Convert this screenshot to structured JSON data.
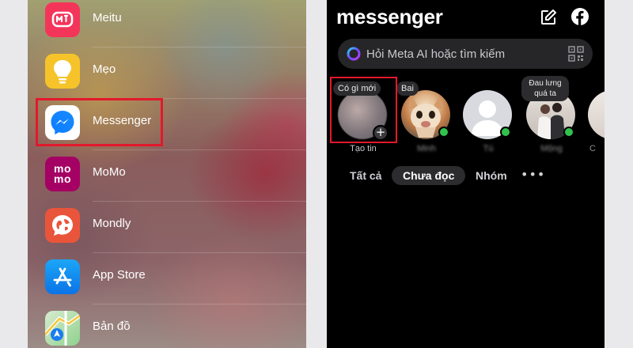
{
  "apps": [
    {
      "id": "meitu",
      "label": "Meitu",
      "icon": "meitu-icon"
    },
    {
      "id": "meo",
      "label": "Mẹo",
      "icon": "lightbulb-icon"
    },
    {
      "id": "messenger",
      "label": "Messenger",
      "icon": "messenger-icon"
    },
    {
      "id": "momo",
      "label": "MoMo",
      "icon": "momo-icon",
      "icon_text_top": "mo",
      "icon_text_bottom": "mo"
    },
    {
      "id": "mondly",
      "label": "Mondly",
      "icon": "globe-chat-icon"
    },
    {
      "id": "appstore",
      "label": "App Store",
      "icon": "app-store-icon"
    },
    {
      "id": "maps",
      "label": "Bản đồ",
      "icon": "maps-icon"
    }
  ],
  "messenger": {
    "title": "messenger",
    "search_placeholder": "Hỏi Meta AI hoặc tìm kiếm",
    "stories": [
      {
        "id": "own",
        "name": "Tạo tin",
        "bubble": "Có gì mới"
      },
      {
        "id": "minh",
        "name": "Minh",
        "bubble": "Bai",
        "online": true
      },
      {
        "id": "tu",
        "name": "Tú",
        "online": true
      },
      {
        "id": "mong",
        "name": "Mộng",
        "bubble": "Đau lưng quá ta",
        "online": true
      },
      {
        "id": "c",
        "name": "C"
      }
    ],
    "filters": [
      {
        "label": "Tất cả",
        "active": false
      },
      {
        "label": "Chưa đọc",
        "active": true
      },
      {
        "label": "Nhóm",
        "active": false
      }
    ],
    "more_label": "•••"
  },
  "colors": {
    "highlight": "#e3182c",
    "online": "#31c24d",
    "messenger_blue": "#0a7cff"
  }
}
